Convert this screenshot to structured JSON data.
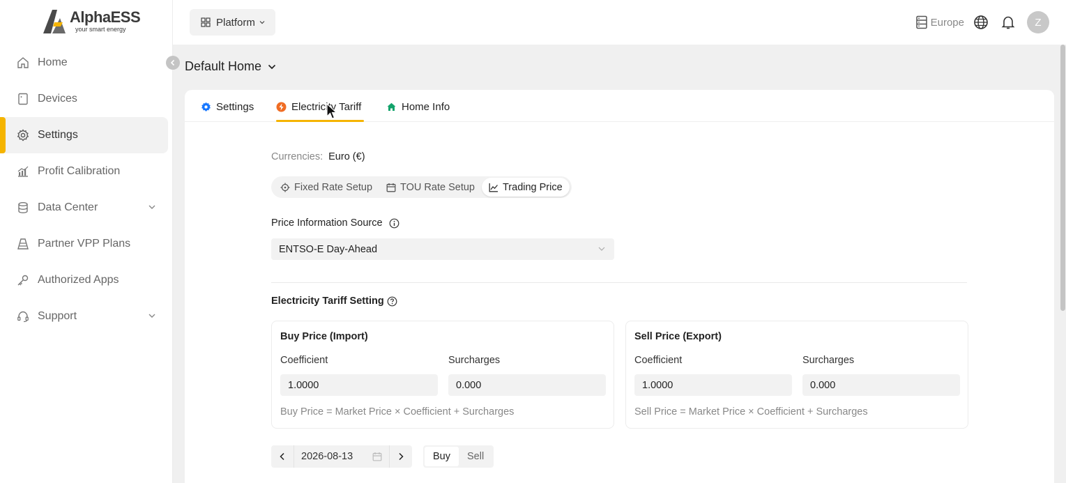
{
  "brand": {
    "name": "AlphaESS",
    "tagline": "your smart energy"
  },
  "sidebar": {
    "items": [
      {
        "label": "Home",
        "icon": "home-icon"
      },
      {
        "label": "Devices",
        "icon": "device-icon"
      },
      {
        "label": "Settings",
        "icon": "gear-icon",
        "active": true
      },
      {
        "label": "Profit Calibration",
        "icon": "chart-icon"
      },
      {
        "label": "Data Center",
        "icon": "database-icon",
        "expandable": true
      },
      {
        "label": "Partner VPP Plans",
        "icon": "tower-icon"
      },
      {
        "label": "Authorized Apps",
        "icon": "key-icon"
      },
      {
        "label": "Support",
        "icon": "headset-icon",
        "expandable": true
      }
    ]
  },
  "header": {
    "platform_label": "Platform",
    "region": "Europe",
    "avatar_initial": "Z"
  },
  "home_selector": {
    "label": "Default Home"
  },
  "tabs": [
    {
      "label": "Settings",
      "icon": "gear-icon",
      "color": "#1677ff"
    },
    {
      "label": "Electricity Tariff",
      "icon": "tariff-icon",
      "color": "#f06c23",
      "active": true
    },
    {
      "label": "Home Info",
      "icon": "house-icon",
      "color": "#12a36b"
    }
  ],
  "tariff": {
    "currency_label": "Currencies",
    "currency_value": "Euro (€)",
    "rate_modes": [
      {
        "label": "Fixed Rate Setup",
        "icon": "target-icon"
      },
      {
        "label": "TOU Rate Setup",
        "icon": "calendar-icon"
      },
      {
        "label": "Trading Price",
        "icon": "line-chart-icon",
        "active": true
      }
    ],
    "price_source_label": "Price Information Source",
    "price_source_value": "ENTSO-E Day-Ahead",
    "setting_title": "Electricity Tariff Setting",
    "buy": {
      "title": "Buy Price (Import)",
      "coefficient_label": "Coefficient",
      "coefficient_value": "1.0000",
      "surcharges_label": "Surcharges",
      "surcharges_value": "0.000",
      "formula": "Buy Price = Market Price × Coefficient + Surcharges"
    },
    "sell": {
      "title": "Sell Price (Export)",
      "coefficient_label": "Coefficient",
      "coefficient_value": "1.0000",
      "surcharges_label": "Surcharges",
      "surcharges_value": "0.000",
      "formula": "Sell Price = Market Price × Coefficient + Surcharges"
    },
    "date_value": "2026-08-13",
    "toggle": {
      "buy_label": "Buy",
      "sell_label": "Sell",
      "active": "Buy"
    }
  },
  "colors": {
    "accent": "#f5b400"
  }
}
